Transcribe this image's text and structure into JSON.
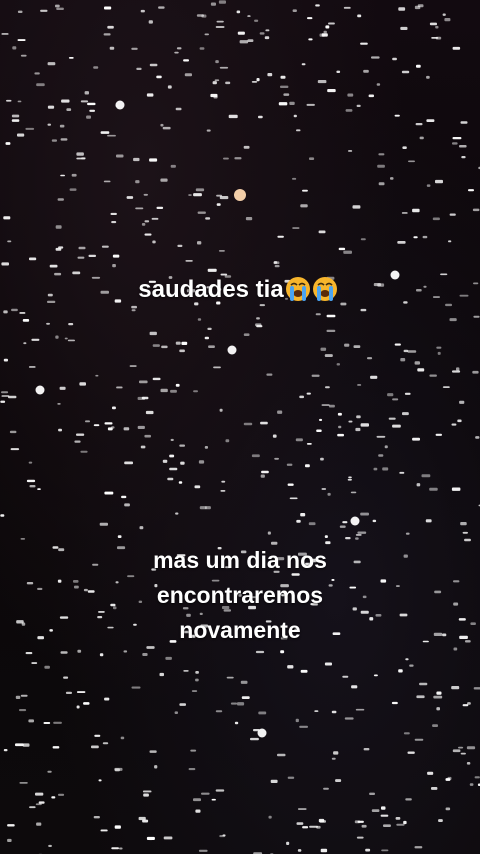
{
  "story": {
    "top_caption": "saudades tia",
    "top_caption_emoji": [
      "loudly-crying-face-icon",
      "loudly-crying-face-icon"
    ],
    "bottom_caption_lines": [
      "mas um dia nos",
      "encontraremos",
      "novamente"
    ]
  },
  "colors": {
    "background": "#0b0709",
    "star": "#ffffff",
    "warm_star": "#ffd9b0",
    "text": "#ffffff",
    "emoji_face": "#f7b52c"
  }
}
